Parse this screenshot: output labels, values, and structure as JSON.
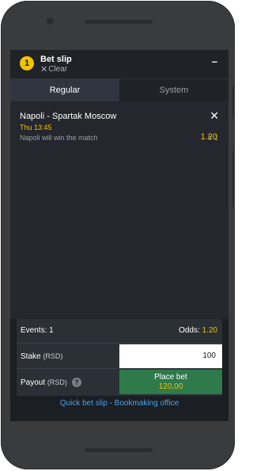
{
  "header": {
    "badge_count": "1",
    "title": "Bet slip",
    "clear_label": "Clear",
    "minimize_icon": "minus"
  },
  "tabs": [
    {
      "label": "Regular",
      "active": true
    },
    {
      "label": "System",
      "active": false
    }
  ],
  "bet": {
    "match": "Napoli - Spartak Moscow",
    "time": "Thu 13:45",
    "selection": "Napoli will win the match",
    "market_code": "fr 1",
    "odd": "1.20"
  },
  "summary": {
    "events_label": "Events: 1",
    "odds_label": "Odds:",
    "odds_value": "1.20",
    "stake_label": "Stake",
    "stake_unit": "(RSD)",
    "stake_value": "100",
    "payout_label": "Payout",
    "payout_unit": "(RSD)",
    "help_symbol": "?",
    "place_bet_label": "Place bet",
    "payout_value": "120,00"
  },
  "quick_link": "Quick bet slip - Bookmaking office",
  "colors": {
    "accent": "#f2c200",
    "place_bet": "#2f7a4a",
    "link": "#4aa3e8"
  }
}
